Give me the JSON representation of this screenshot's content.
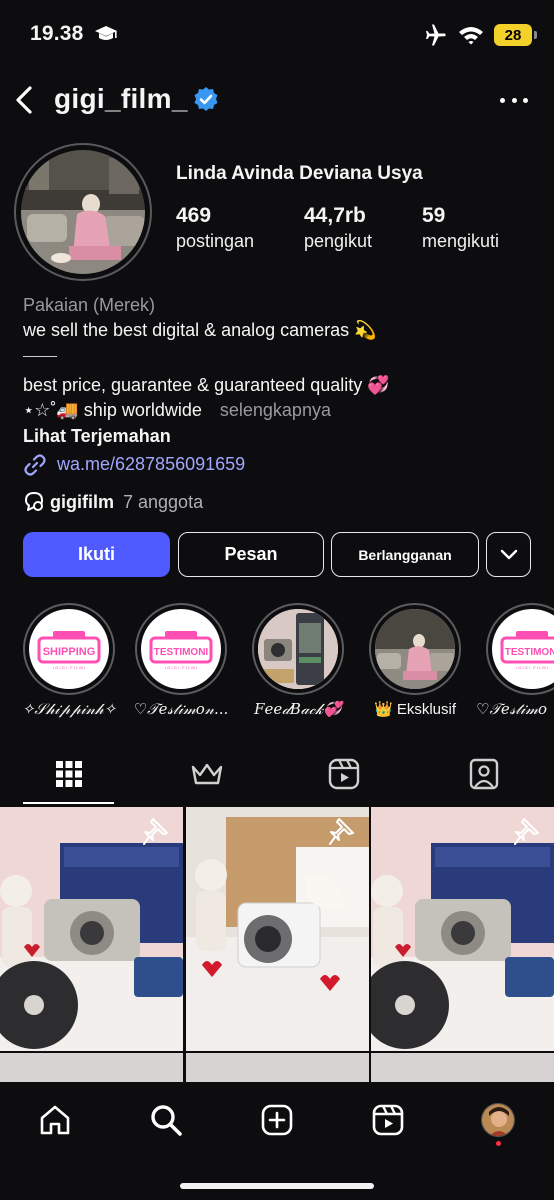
{
  "status_bar": {
    "time": "19.38",
    "battery": "28"
  },
  "header": {
    "username": "gigi_film_"
  },
  "profile": {
    "full_name": "Linda Avinda Deviana Usya",
    "stats": [
      {
        "value": "469",
        "label": "postingan"
      },
      {
        "value": "44,7rb",
        "label": "pengikut"
      },
      {
        "value": "59",
        "label": "mengikuti"
      }
    ],
    "category": "Pakaian (Merek)",
    "bio_line1": "we sell the best digital & analog cameras 💫",
    "bio_line2": "best price, guarantee & guaranteed quality 💞",
    "bio_line3": "⋆☆˚🚚 ship worldwide",
    "more_label": "selengkapnya",
    "translate_label": "Lihat Terjemahan",
    "link": "wa.me/6287856091659",
    "channel_name": "gigifilm",
    "channel_members": "7 anggota"
  },
  "actions": {
    "follow": "Ikuti",
    "message": "Pesan",
    "subscribe": "Berlangganan"
  },
  "highlights": [
    {
      "label": "✧𝒮𝒽𝒾𝓅𝓅𝒾𝓃𝒽✧",
      "badge": "SHIPPING"
    },
    {
      "label": "♡𝒯𝑒𝓈𝓉𝒾𝓂𝑜𝓃...",
      "badge": "TESTIMONI"
    },
    {
      "label": "𝐹𝑒𝑒𝒹𝐵𝒶𝒸𝓀💞",
      "badge": ""
    },
    {
      "label": "👑 Eksklusif",
      "badge": ""
    },
    {
      "label": "♡𝒯𝑒𝓈𝓉𝒾𝓂𝑜",
      "badge": "TESTIMONI"
    }
  ],
  "highlight_badge_sub": "• G I G I . F I L M •",
  "tabs": [
    "grid-icon",
    "crown-icon",
    "reels-icon",
    "tagged-icon"
  ],
  "bottom_nav": [
    "home-icon",
    "search-icon",
    "create-icon",
    "reels-icon",
    "profile-avatar"
  ],
  "colors": {
    "accent": "#4f5bff",
    "link": "#a1a7ff",
    "badge_pink": "#ff4fb4",
    "background": "#0d0d0f"
  }
}
